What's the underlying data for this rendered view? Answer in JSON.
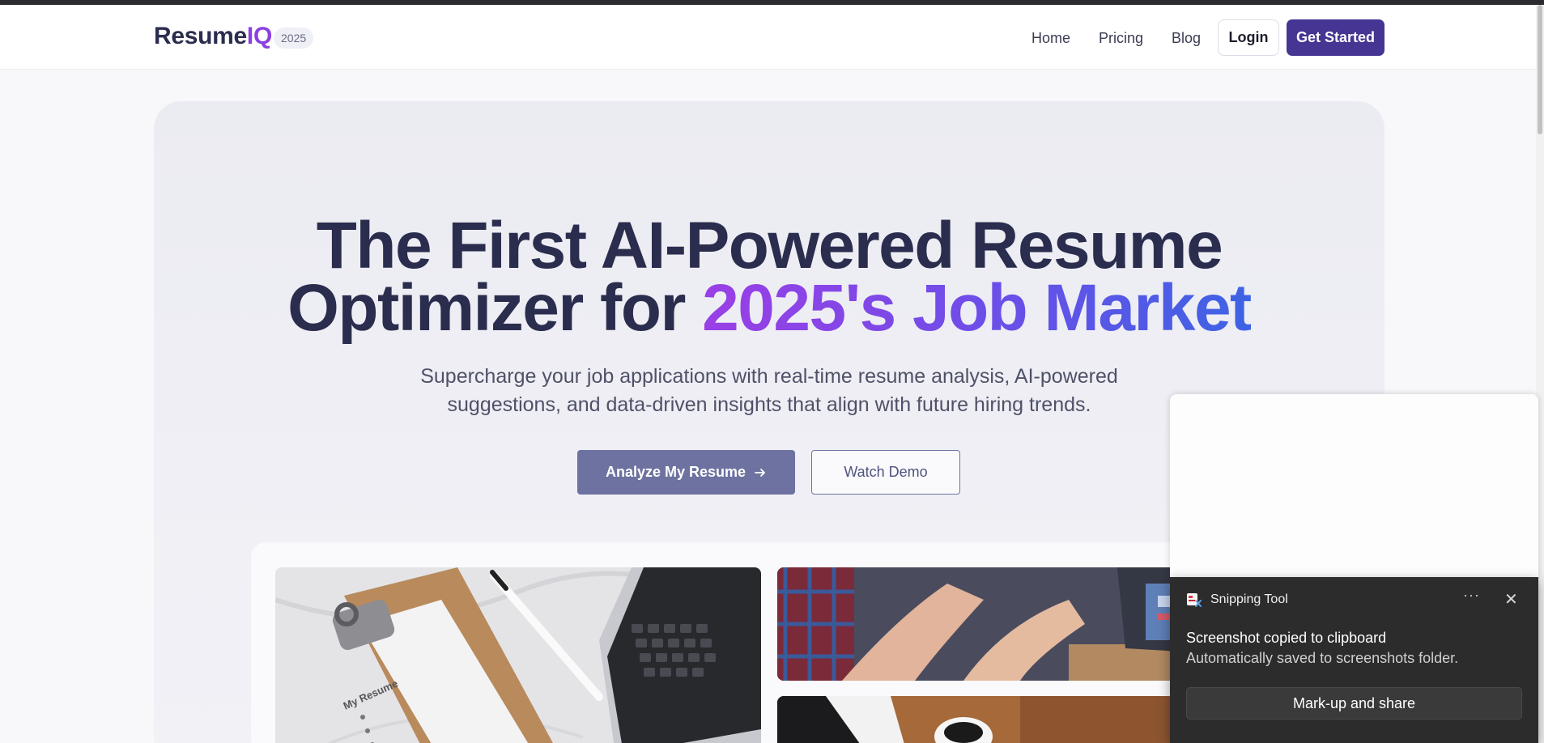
{
  "nav": {
    "logo_main": "Resume",
    "logo_accent": "IQ",
    "year_badge": "2025",
    "links": [
      "Home",
      "Pricing",
      "Blog"
    ],
    "login_label": "Login",
    "get_started_label": "Get Started"
  },
  "hero": {
    "headline_line1": "The First AI-Powered Resume",
    "headline_line2_prefix": "Optimizer for ",
    "headline_line2_highlight": "2025's Job Market",
    "subtitle_line1": "Supercharge your job applications with real-time resume analysis, AI-powered",
    "subtitle_line2": "suggestions, and data-driven insights that align with future hiring trends.",
    "primary_cta": "Analyze My Resume",
    "secondary_cta": "Watch Demo"
  },
  "showcase": {
    "clipboard_paper_text": "My Resume"
  },
  "toast": {
    "app_name": "Snipping Tool",
    "more_label": "···",
    "close_label": "✕",
    "title": "Screenshot copied to clipboard",
    "message": "Automatically saved to screenshots folder.",
    "action_label": "Mark-up and share"
  },
  "colors": {
    "brand_primary": "#463592",
    "accent_purple": "#8b3fe0",
    "gradient_start": "#9a3fe6",
    "gradient_end": "#3d63e4",
    "text_dark": "#2b2d4e"
  }
}
